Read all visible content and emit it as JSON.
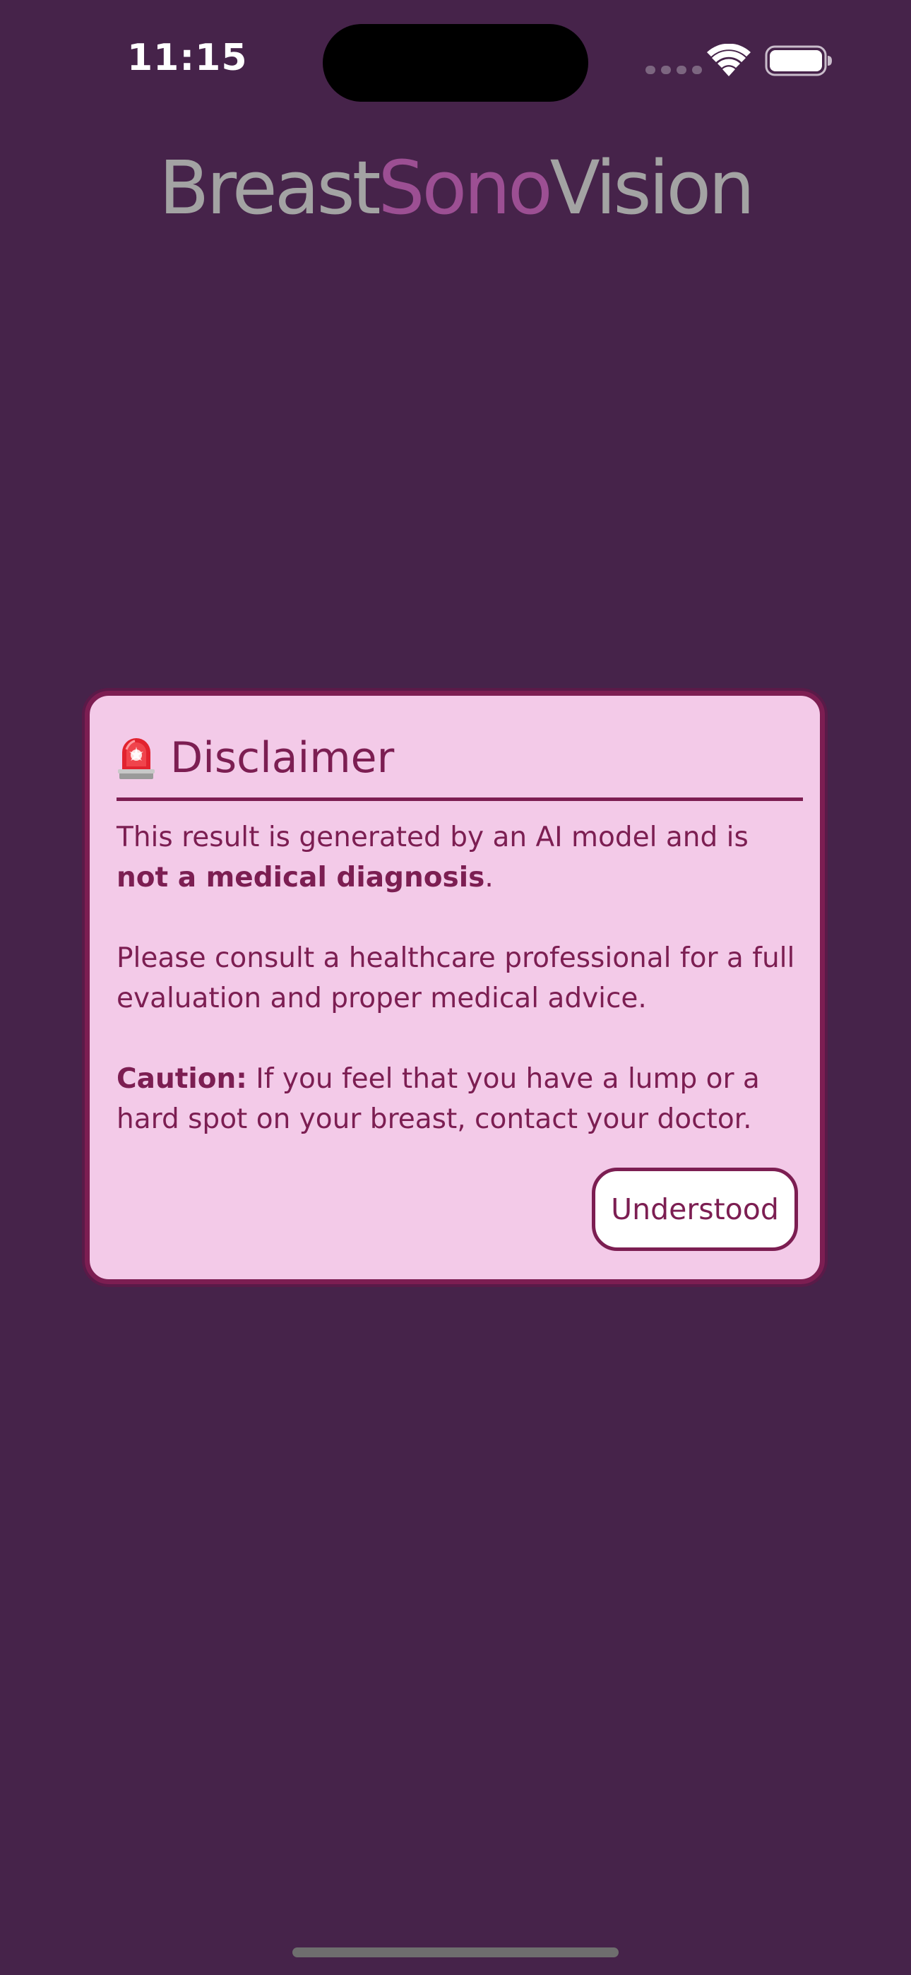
{
  "status_bar": {
    "time": "11:15",
    "signal_icon": "cellular-signal-icon",
    "wifi_icon": "wifi-icon",
    "battery_icon": "battery-icon"
  },
  "app": {
    "title_part1": "Breast",
    "title_part2": "Sono",
    "title_part3": "Vision",
    "title_colors": {
      "base": "#a3a3a3",
      "accent": "#9c4f93"
    },
    "background_color": "#46234a"
  },
  "disclaimer": {
    "icon": "siren-icon",
    "title": "Disclaimer",
    "p1_text": "This result is generated by an AI model and is ",
    "p1_bold": "not a medical diagnosis",
    "p1_end": ".",
    "p2": "Please consult a healthcare professional for a full evaluation and proper medical advice.",
    "p3_bold": "Caution:",
    "p3_text": " If you feel that you have a lump or a hard spot on your breast, contact your doctor.",
    "button_label": "Understood",
    "colors": {
      "card_background": "#f3cae8",
      "accent": "#7c1e52"
    }
  }
}
